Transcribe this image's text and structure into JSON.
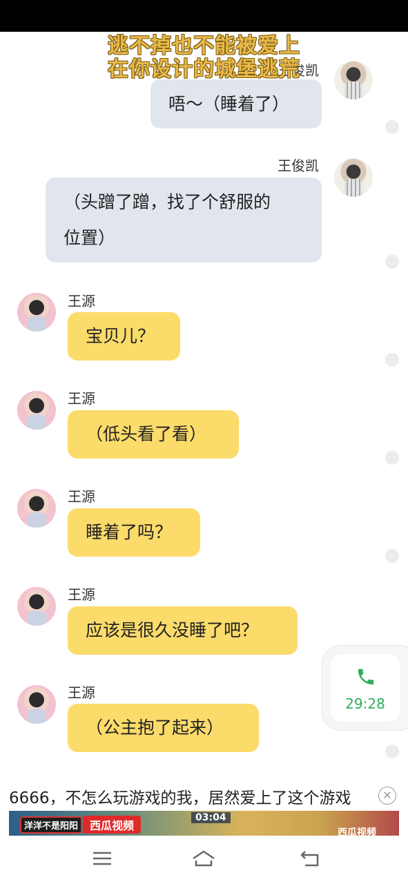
{
  "lyrics": {
    "line1": "逃不掉也不能被爱上",
    "line2": "在你设计的城堡逃荒"
  },
  "messages": [
    {
      "side": "right",
      "sender": "王俊凯",
      "text": "唔～（睡着了）",
      "color": "grey"
    },
    {
      "side": "right",
      "sender": "王俊凯",
      "text_line1": "（头蹭了蹭，找了个舒服的",
      "text_line2": "位置）",
      "color": "grey"
    },
    {
      "side": "left",
      "sender": "王源",
      "text": "宝贝儿？",
      "color": "yellow"
    },
    {
      "side": "left",
      "sender": "王源",
      "text": "（低头看了看）",
      "color": "yellow"
    },
    {
      "side": "left",
      "sender": "王源",
      "text": "睡着了吗？",
      "color": "yellow"
    },
    {
      "side": "left",
      "sender": "王源",
      "text": "应该是很久没睡了吧？",
      "color": "yellow"
    },
    {
      "side": "left",
      "sender": "王源",
      "text": "（公主抱了起来）",
      "color": "yellow"
    }
  ],
  "call_widget": {
    "icon": "phone-icon",
    "time": "29:28",
    "color": "#2fae5e"
  },
  "ad": {
    "title": "6666，不怎么玩游戏的我，居然爱上了这个游戏",
    "tag1": "洋洋不是阳阳",
    "tag2": "西瓜视频",
    "game_time": "03:04",
    "brand": "西瓜视频"
  },
  "nav": {
    "menu_icon": "menu-icon",
    "home_icon": "home-icon",
    "back_icon": "back-icon"
  },
  "colors": {
    "grey_bubble": "#e1e6ee",
    "yellow_bubble": "#fbdb6a",
    "lyrics": "#e9b949"
  }
}
